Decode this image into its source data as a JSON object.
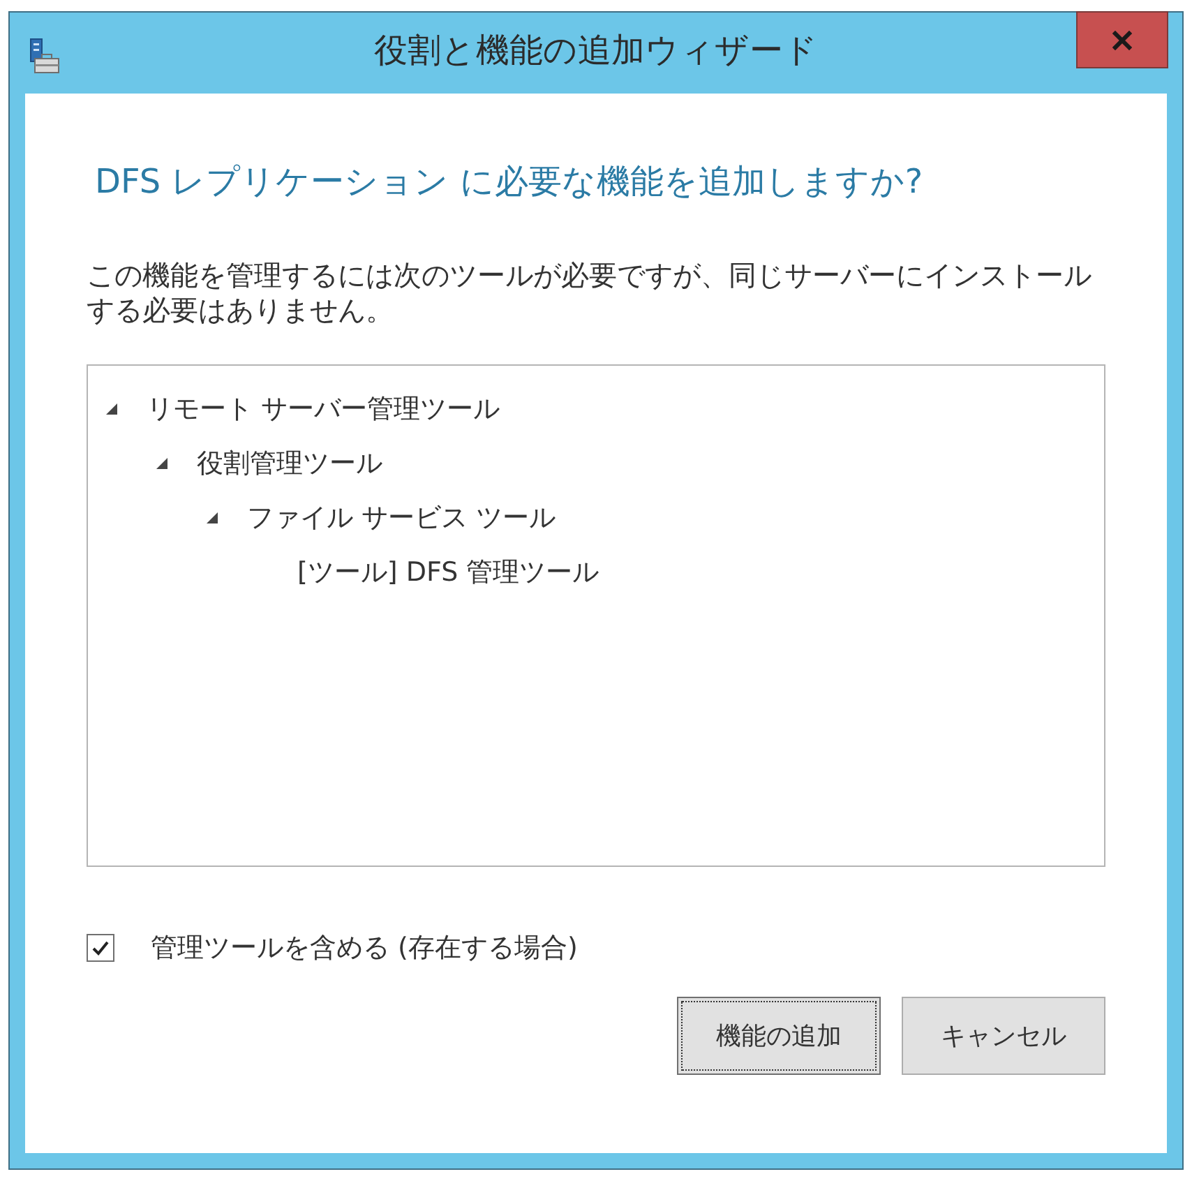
{
  "window": {
    "title": "役割と機能の追加ウィザード"
  },
  "heading": "DFS レプリケーション に必要な機能を追加しますか?",
  "description": "この機能を管理するには次のツールが必要ですが、同じサーバーにインストールする必要はありません。",
  "tree": [
    {
      "label": "リモート サーバー管理ツール",
      "expanded": true,
      "children": [
        {
          "label": "役割管理ツール",
          "expanded": true,
          "children": [
            {
              "label": "ファイル サービス ツール",
              "expanded": true,
              "children": [
                {
                  "label": "[ツール] DFS 管理ツール"
                }
              ]
            }
          ]
        }
      ]
    }
  ],
  "include_tools": {
    "label": "管理ツールを含める (存在する場合)",
    "checked": true
  },
  "buttons": [
    {
      "label": "機能の追加",
      "focused": true
    },
    {
      "label": "キャンセル",
      "focused": false
    }
  ]
}
